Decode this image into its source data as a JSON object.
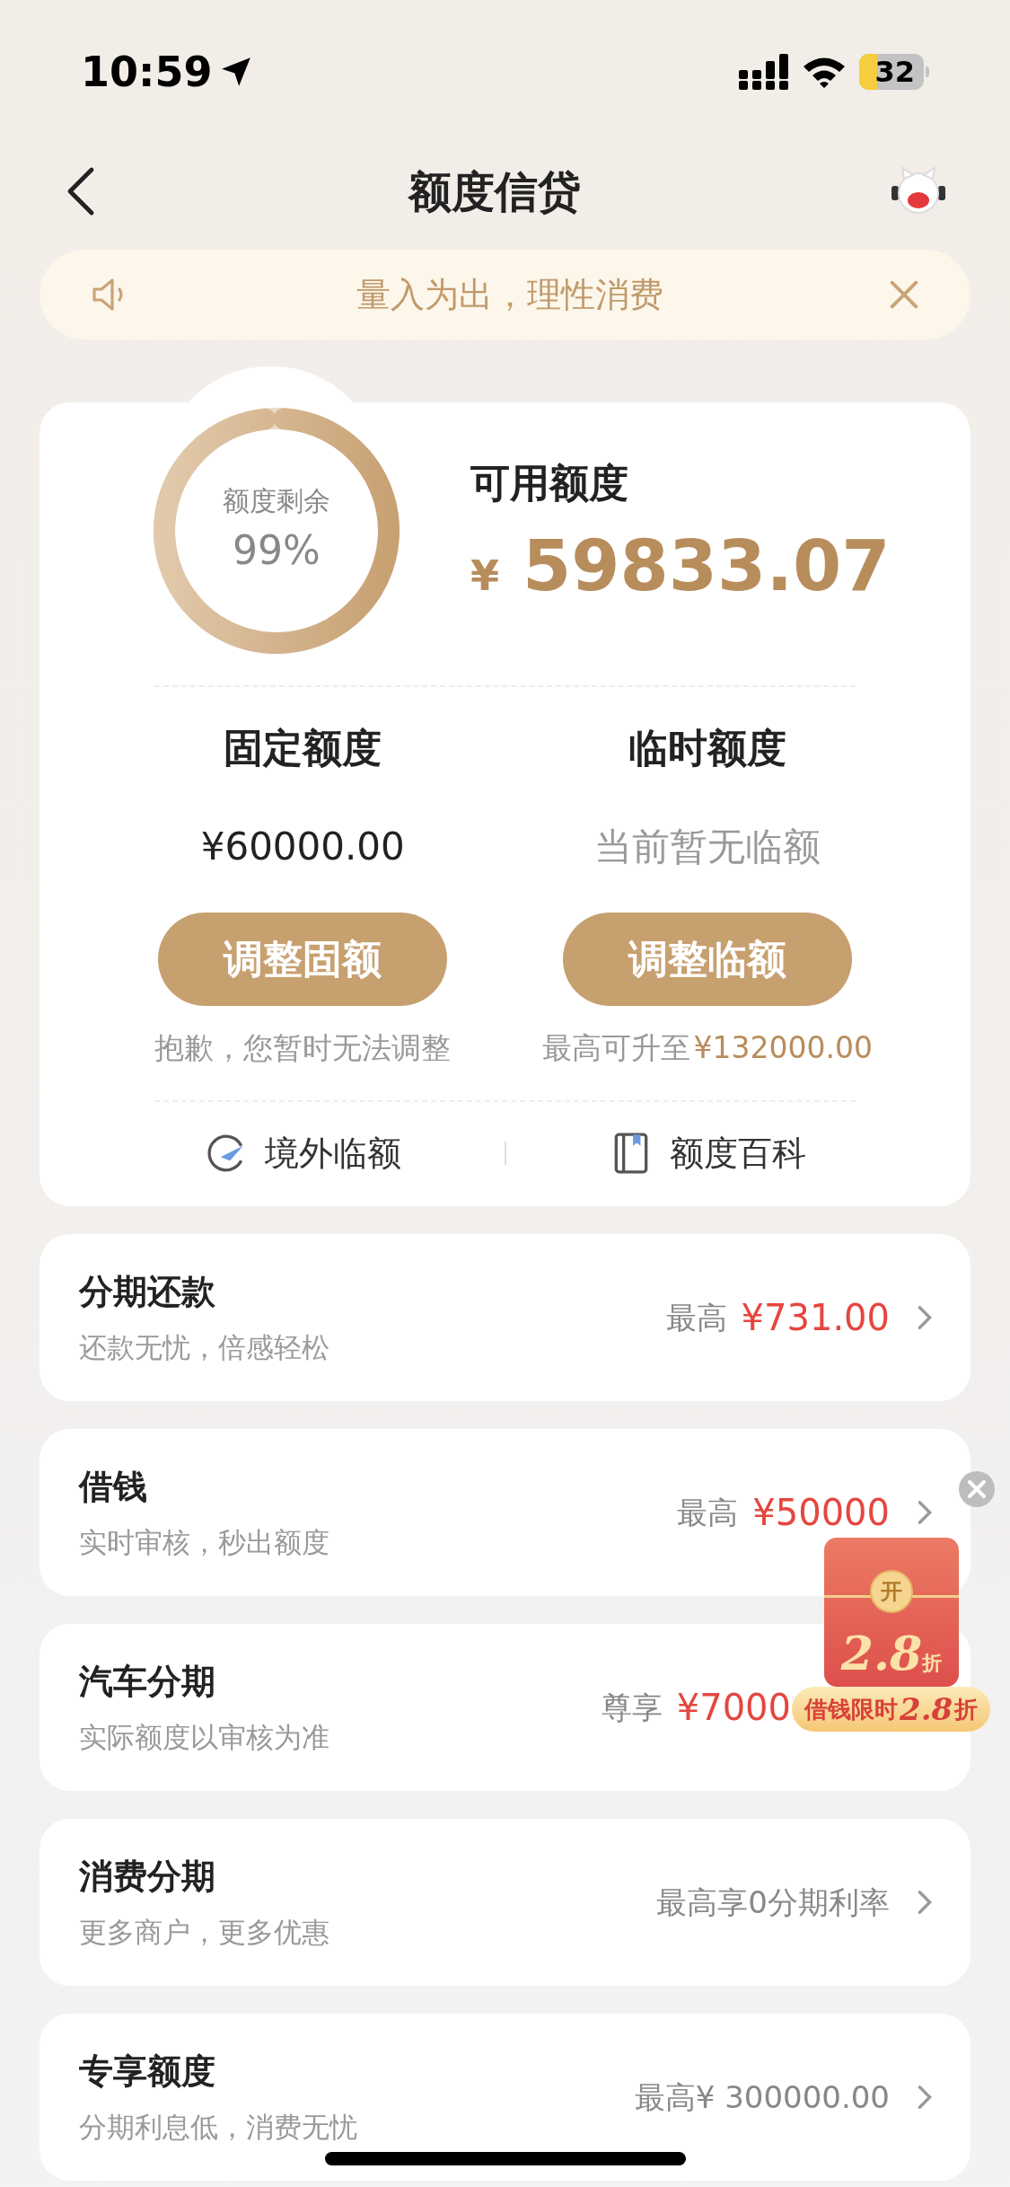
{
  "status_bar": {
    "time": "10:59",
    "battery": "32"
  },
  "nav": {
    "title": "额度信贷"
  },
  "notice": {
    "text": "量入为出，理性消费"
  },
  "credit_card": {
    "ring_label": "额度剩余",
    "ring_percent": "99%",
    "level": 0.99,
    "available_label": "可用额度",
    "currency": "¥",
    "amount": "59833.07",
    "columns": [
      {
        "title": "固定额度",
        "value": "¥60000.00",
        "muted": false,
        "button": "调整固额",
        "note": "抱歉，您暂时无法调整"
      },
      {
        "title": "临时额度",
        "value": "当前暂无临额",
        "muted": true,
        "button": "调整临额",
        "note": "最高可升至",
        "note_amount": "¥132000.00"
      }
    ],
    "links": [
      {
        "label": "境外临额",
        "kind": "plane"
      },
      {
        "label": "额度百科",
        "kind": "book"
      }
    ]
  },
  "products": [
    {
      "title": "分期还款",
      "subtitle": "还款无忧，倍感轻松",
      "prefix": "最高",
      "amount": "¥731.00",
      "chevron": true
    },
    {
      "title": "借钱",
      "subtitle": "实时审核，秒出额度",
      "prefix": "最高",
      "amount": "¥50000",
      "chevron": true
    },
    {
      "title": "汽车分期",
      "subtitle": "实际额度以审核为准",
      "prefix": "尊享",
      "amount": "¥7000",
      "chevron": false
    },
    {
      "title": "消费分期",
      "subtitle": "更多商户，更多优惠",
      "prefix": "最高享0分期利率",
      "chevron": true
    },
    {
      "title": "专享额度",
      "subtitle": "分期利息低，消费无忧",
      "prefix": "最高¥ 300000.00",
      "chevron": true
    }
  ],
  "promo": {
    "badge": "开",
    "discount": "2.8",
    "unit": "折",
    "caption": "借钱限时",
    "caption_number": "2.8",
    "caption_unit": "折"
  }
}
